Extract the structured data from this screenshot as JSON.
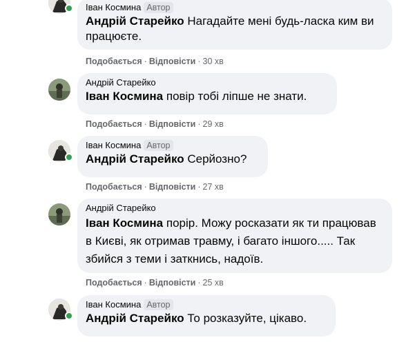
{
  "comments": [
    {
      "author": "Іван Космина",
      "badge": "Автор",
      "mention": "Андрій Старейко",
      "text": " Нагадайте мені будь-ласка ким ви працюєте.",
      "like": "Подобається",
      "reply": "Відповісти",
      "time": "30 хв"
    },
    {
      "author": "Андрій Старейко",
      "badge": "",
      "mention": "Іван Космина",
      "text": " повір тобі ліпше не знати.",
      "like": "Подобається",
      "reply": "Відповісти",
      "time": "29 хв"
    },
    {
      "author": "Іван Космина",
      "badge": "Автор",
      "mention": "Андрій Старейко",
      "text": " Серйозно?",
      "like": "Подобається",
      "reply": "Відповісти",
      "time": "27 хв"
    },
    {
      "author": "Андрій Старейко",
      "badge": "",
      "mention": "Іван Космина",
      "text": " порір. Можу росказати як ти працював в Києві, як отримав травму, і багато іншого..... Так збийся з теми і заткнись, надоїв.",
      "like": "Подобається",
      "reply": "Відповісти",
      "time": "25 хв"
    },
    {
      "author": "Іван Космина",
      "badge": "Автор",
      "mention": "Андрій Старейко",
      "text": " То розказуйте, цікаво.",
      "like": "Подобається",
      "reply": "Відповісти",
      "time": ""
    }
  ],
  "separator": "·",
  "colors": {
    "bubble": "#f0f2f5",
    "secondary_text": "#65676b",
    "online": "#31a24c"
  }
}
